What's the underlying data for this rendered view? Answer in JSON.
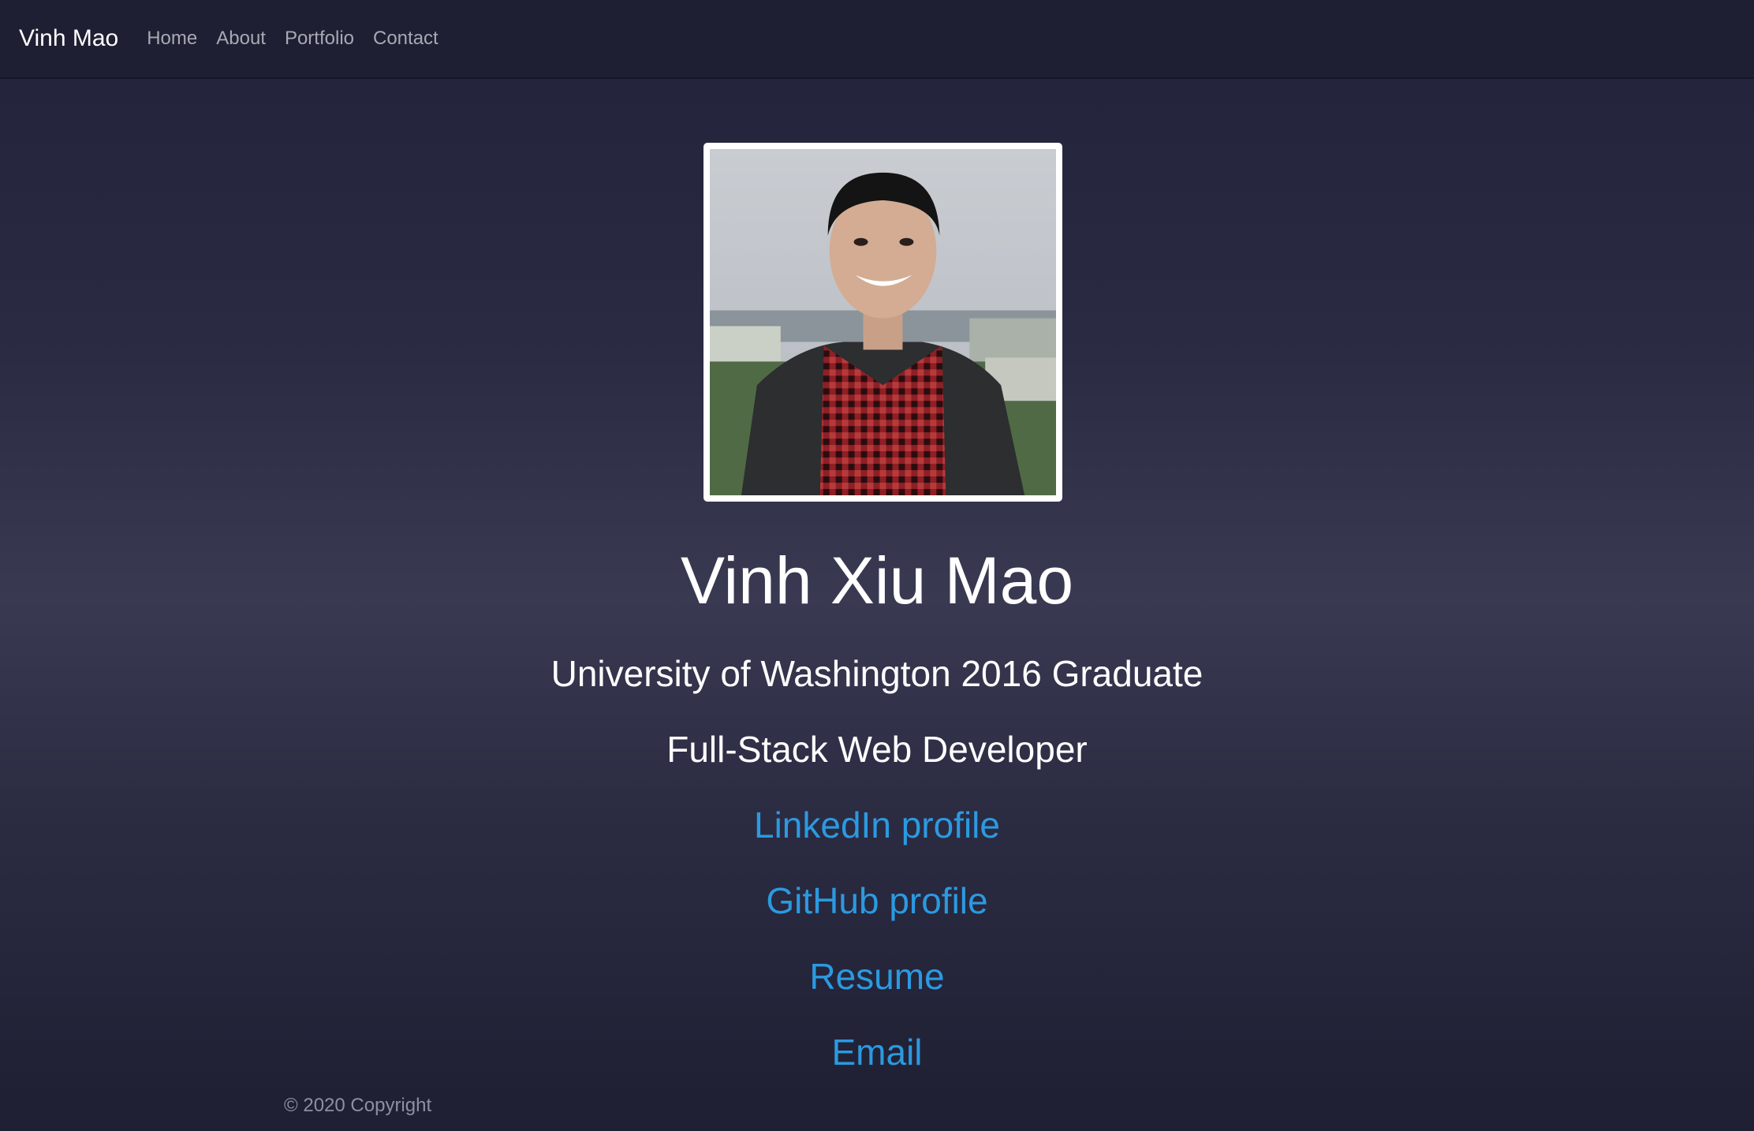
{
  "nav": {
    "brand": "Vinh Mao",
    "links": [
      "Home",
      "About",
      "Portfolio",
      "Contact"
    ]
  },
  "profile": {
    "name": "Vinh Xiu Mao",
    "education": "University of Washington 2016 Graduate",
    "role": "Full-Stack Web Developer"
  },
  "links": {
    "linkedin": "LinkedIn profile",
    "github": "GitHub profile",
    "resume": "Resume",
    "email": "Email"
  },
  "footer": {
    "copyright": "© 2020 Copyright"
  },
  "colors": {
    "accent_link": "#2b9ae0",
    "navbar_bg": "#1f1f33",
    "text": "#ffffff"
  }
}
